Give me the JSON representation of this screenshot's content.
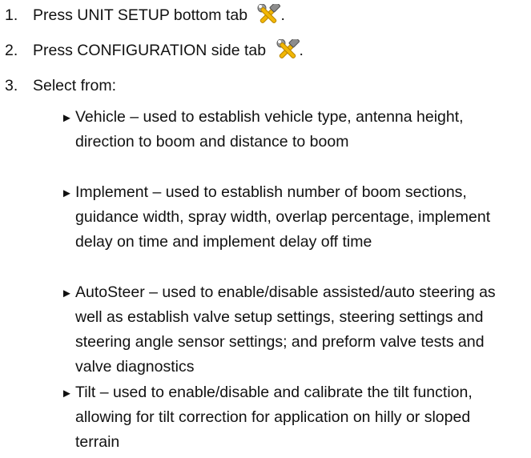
{
  "steps": [
    {
      "number": "1.",
      "text": "Press UNIT SETUP bottom tab",
      "trailing": ".",
      "icon": "tools-icon"
    },
    {
      "number": "2.",
      "text": "Press CONFIGURATION side tab",
      "trailing": ".",
      "icon": "tools-icon"
    },
    {
      "number": "3.",
      "text": "Select from:"
    }
  ],
  "options": [
    {
      "bullet": "►",
      "lines": [
        "Vehicle – used to establish vehicle type, antenna height,",
        "direction to boom and distance to boom"
      ]
    },
    {
      "bullet": "►",
      "lines": [
        "Implement – used to establish number of boom sections,",
        "guidance width, spray width, overlap percentage, implement",
        "delay on time and implement delay off time"
      ]
    },
    {
      "bullet": "►",
      "lines": [
        "AutoSteer – used to enable/disable assisted/auto steering as",
        "well as establish valve setup settings, steering settings and",
        "steering angle sensor settings; and preform valve tests and",
        "valve diagnostics"
      ]
    },
    {
      "bullet": "►",
      "lines": [
        "Tilt – used to enable/disable and calibrate the tilt function,",
        "allowing for tilt correction for application on hilly or sloped",
        "terrain"
      ]
    }
  ],
  "colors": {
    "text": "#111111",
    "wrench_handle": "#f2b705",
    "hammer_head": "#8c8c8c"
  }
}
